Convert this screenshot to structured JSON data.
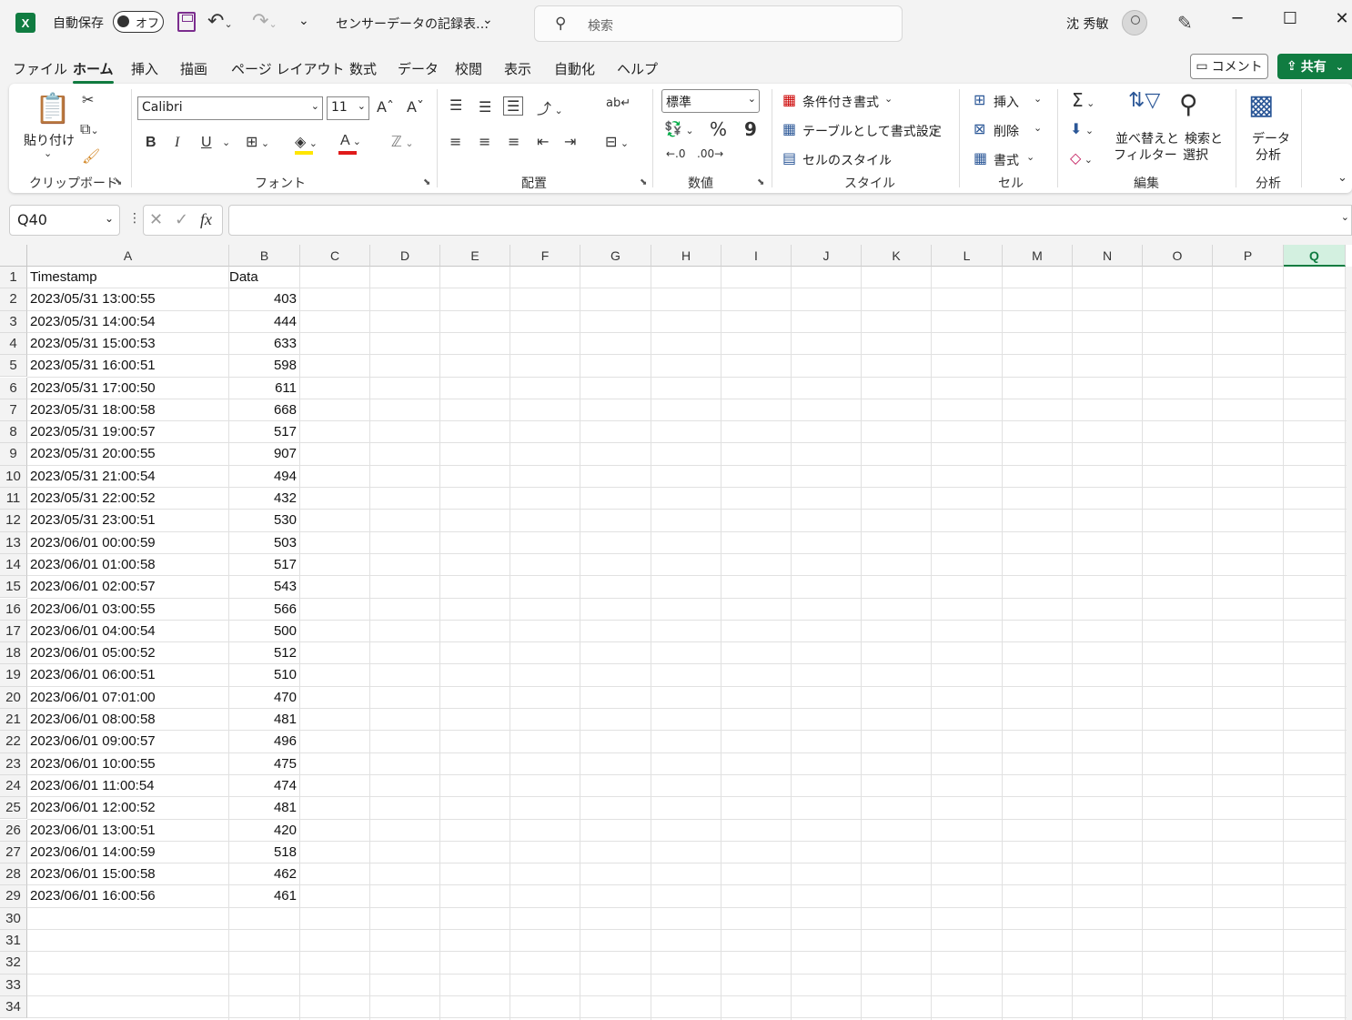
{
  "titlebar": {
    "app_icon": "X",
    "autosave_label": "自動保存",
    "autosave_state": "オフ",
    "doc_title": "センサーデータの記録表…",
    "search_placeholder": "検索",
    "user_name": "沈 秀敏",
    "window_buttons": [
      "─",
      "☐",
      "✕"
    ]
  },
  "menu": {
    "tabs": [
      "ファイル",
      "ホーム",
      "挿入",
      "描画",
      "ページ レイアウト",
      "数式",
      "データ",
      "校閲",
      "表示",
      "自動化",
      "ヘルプ"
    ],
    "active_tab": "ホーム",
    "comment_label": "コメント",
    "share_label": "共有"
  },
  "ribbon": {
    "clipboard": {
      "paste_label1": "貼り付け",
      "group_label": "クリップボード"
    },
    "font": {
      "font_name": "Calibri",
      "font_size": "11",
      "group_label": "フォント",
      "bold": "B",
      "italic": "I",
      "underline": "U"
    },
    "alignment": {
      "group_label": "配置"
    },
    "number": {
      "format": "標準",
      "percent": "%",
      "comma": "9",
      "group_label": "数値"
    },
    "styles": {
      "conditional": "条件付き書式",
      "as_table": "テーブルとして書式設定",
      "cell_styles": "セルのスタイル",
      "group_label": "スタイル"
    },
    "cells": {
      "insert": "挿入",
      "delete": "削除",
      "format": "書式",
      "group_label": "セル"
    },
    "editing": {
      "sort_line1": "並べ替えと",
      "sort_line2": "フィルター",
      "find_line1": "検索と",
      "find_line2": "選択",
      "group_label": "編集"
    },
    "analysis": {
      "line1": "データ",
      "line2": "分析",
      "group_label": "分析"
    }
  },
  "formula_bar": {
    "name_box": "Q40",
    "fx": "fx",
    "content": ""
  },
  "sheet": {
    "columns": [
      "A",
      "B",
      "C",
      "D",
      "E",
      "F",
      "G",
      "H",
      "I",
      "J",
      "K",
      "L",
      "M",
      "N",
      "O",
      "P",
      "Q"
    ],
    "selected_column": "Q",
    "row_numbers": [
      "1",
      "2",
      "3",
      "4",
      "5",
      "6",
      "7",
      "8",
      "9",
      "10",
      "11",
      "12",
      "13",
      "14",
      "15",
      "16",
      "17",
      "18",
      "19",
      "20",
      "21",
      "22",
      "23",
      "24",
      "25",
      "26",
      "27",
      "28",
      "29",
      "30",
      "31",
      "32",
      "33",
      "34"
    ],
    "header": [
      "Timestamp",
      "Data"
    ],
    "rows": [
      [
        "2023/05/31 13:00:55",
        "403"
      ],
      [
        "2023/05/31 14:00:54",
        "444"
      ],
      [
        "2023/05/31 15:00:53",
        "633"
      ],
      [
        "2023/05/31 16:00:51",
        "598"
      ],
      [
        "2023/05/31 17:00:50",
        "611"
      ],
      [
        "2023/05/31 18:00:58",
        "668"
      ],
      [
        "2023/05/31 19:00:57",
        "517"
      ],
      [
        "2023/05/31 20:00:55",
        "907"
      ],
      [
        "2023/05/31 21:00:54",
        "494"
      ],
      [
        "2023/05/31 22:00:52",
        "432"
      ],
      [
        "2023/05/31 23:00:51",
        "530"
      ],
      [
        "2023/06/01 00:00:59",
        "503"
      ],
      [
        "2023/06/01 01:00:58",
        "517"
      ],
      [
        "2023/06/01 02:00:57",
        "543"
      ],
      [
        "2023/06/01 03:00:55",
        "566"
      ],
      [
        "2023/06/01 04:00:54",
        "500"
      ],
      [
        "2023/06/01 05:00:52",
        "512"
      ],
      [
        "2023/06/01 06:00:51",
        "510"
      ],
      [
        "2023/06/01 07:01:00",
        "470"
      ],
      [
        "2023/06/01 08:00:58",
        "481"
      ],
      [
        "2023/06/01 09:00:57",
        "496"
      ],
      [
        "2023/06/01 10:00:55",
        "475"
      ],
      [
        "2023/06/01 11:00:54",
        "474"
      ],
      [
        "2023/06/01 12:00:52",
        "481"
      ],
      [
        "2023/06/01 13:00:51",
        "420"
      ],
      [
        "2023/06/01 14:00:59",
        "518"
      ],
      [
        "2023/06/01 15:00:58",
        "462"
      ],
      [
        "2023/06/01 16:00:56",
        "461"
      ]
    ]
  }
}
